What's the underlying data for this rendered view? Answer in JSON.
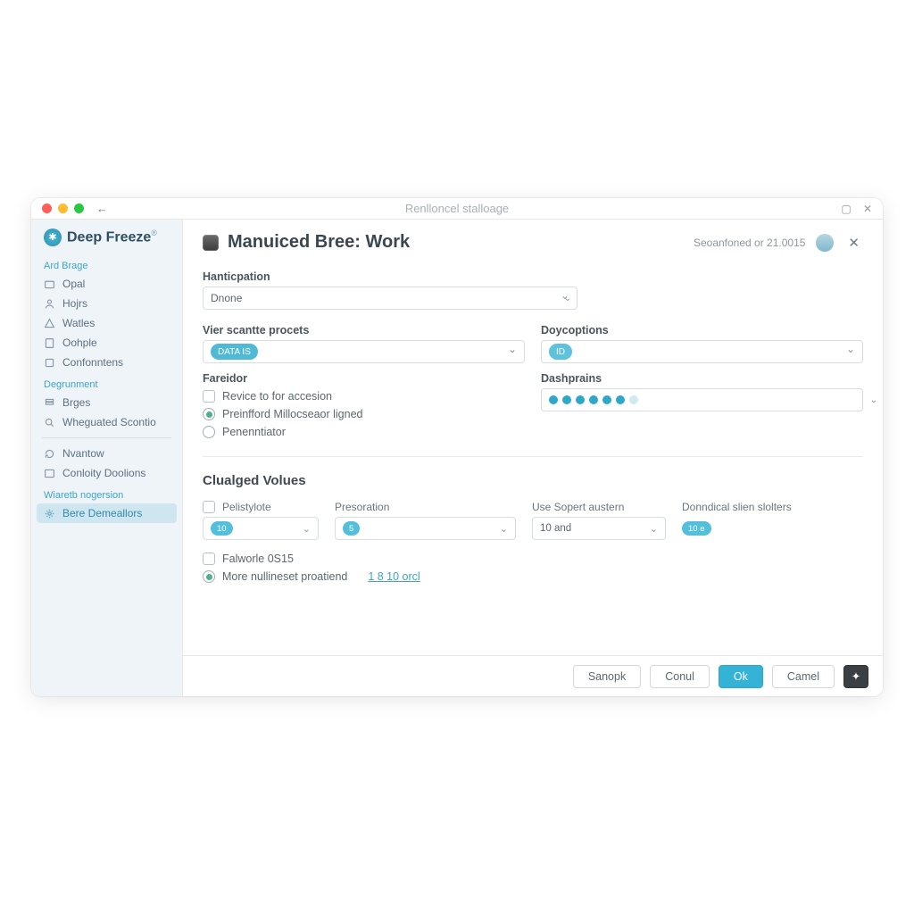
{
  "titlebar": {
    "title": "Renlloncel stalloage"
  },
  "brand": {
    "name": "Deep Freeze"
  },
  "sidebar": {
    "group1_label": "Ard Brage",
    "group1": [
      {
        "label": "Opal"
      },
      {
        "label": "Hojrs"
      },
      {
        "label": "Watles"
      },
      {
        "label": "Oohple"
      },
      {
        "label": "Confonntens"
      }
    ],
    "group2_label": "Degrunment",
    "group2": [
      {
        "label": "Brges"
      },
      {
        "label": "Wheguated Scontio"
      }
    ],
    "group3": [
      {
        "label": "Nvantow"
      },
      {
        "label": "Conloity Doolions"
      }
    ],
    "group4_label": "Wiaretb nogersion",
    "group4": [
      {
        "label": "Bere Demeallors"
      }
    ]
  },
  "header": {
    "title": "Manuiced Bree: Work",
    "status": "Seoanfoned or 21.0015"
  },
  "form": {
    "hanticpation_label": "Hanticpation",
    "hanticpation_value": "Dnone",
    "vier_label": "Vier scantte procets",
    "vier_pill": "DATA IS",
    "doycoptions_label": "Doycoptions",
    "doycoptions_pill": "ID",
    "fareidor_label": "Fareidor",
    "opt1": "Revice to for accesion",
    "opt2": "Preinfford Millocseaor ligned",
    "opt3": "Penenntiator",
    "dashprains_label": "Dashprains",
    "section2_title": "Clualged Volues",
    "cb_pelistylote": "Pelistylote",
    "presoration_label": "Presoration",
    "presoration_pill": "5",
    "use_super_label": "Use Sopert austern",
    "use_super_value": "10 and",
    "donndical_label": "Donndical slien slolters",
    "donndical_pill": "10 e",
    "pelistylote_pill": "10",
    "cb_falworle": "Falworle 0S15",
    "more_label": "More nullineset proatiend",
    "more_link": "1 8 10 orcl"
  },
  "footer": {
    "sanopk": "Sanopk",
    "conul": "Conul",
    "ok": "Ok",
    "camel": "Camel"
  }
}
